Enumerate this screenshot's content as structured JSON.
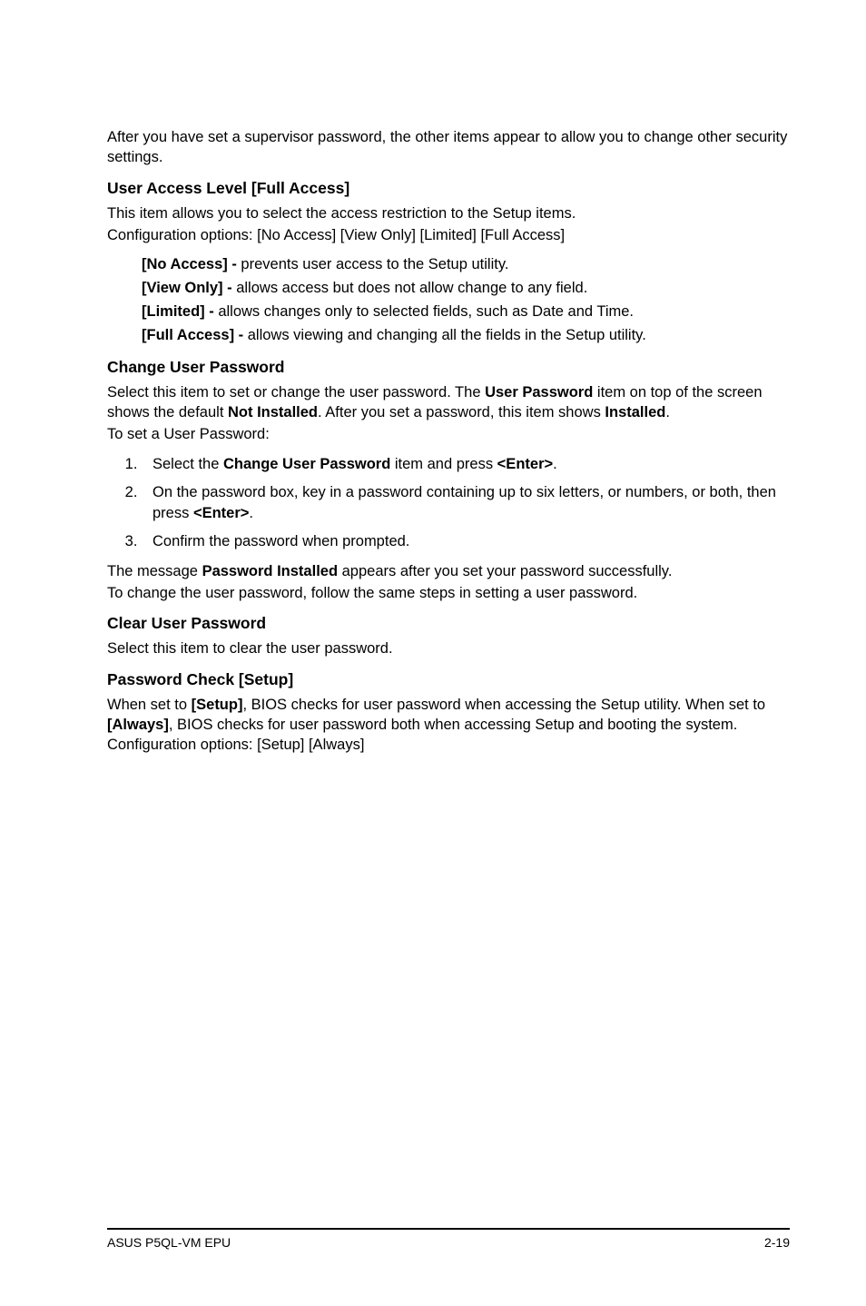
{
  "intro": "After you have set a supervisor password, the other items appear to allow you to change other security settings.",
  "ual": {
    "heading": "User Access Level [Full Access]",
    "desc1": "This item allows you to select the access restriction to the Setup items.",
    "desc2": "Configuration options: [No Access] [View Only] [Limited] [Full Access]",
    "opts": {
      "na_b": "[No Access] - ",
      "na_t": "prevents user access to the Setup utility.",
      "vo_b": "[View Only] - ",
      "vo_t": "allows access but does not allow change to any field.",
      "li_b": "[Limited] - ",
      "li_t": "allows changes only to selected fields, such as Date and Time.",
      "fa_b": "[Full Access] - ",
      "fa_t": "allows viewing and changing all the fields in the Setup utility."
    }
  },
  "cup": {
    "heading": "Change User Password",
    "p1a": "Select this item to set or change the user password. The ",
    "p1b": "User Password",
    "p1c": " item on top of the screen shows the default ",
    "p1d": "Not Installed",
    "p1e": ". After you set a password, this item shows ",
    "p1f": "Installed",
    "p1g": ".",
    "p2": "To set a User Password:",
    "s1a": "Select the ",
    "s1b": "Change User Password",
    "s1c": " item and press ",
    "s1d": "<Enter>",
    "s1e": ".",
    "s2a": "On the password box, key in a password containing up to six letters, or numbers, or both, then press ",
    "s2b": "<Enter>",
    "s2c": ".",
    "s3": "Confirm the password when prompted.",
    "p3a": "The message ",
    "p3b": "Password Installed",
    "p3c": " appears after you set your password successfully.",
    "p4": "To change the user password, follow the same steps in setting a user password."
  },
  "clr": {
    "heading": "Clear User Password",
    "p": "Select this item to clear the user password."
  },
  "pwc": {
    "heading": "Password Check [Setup]",
    "a": "When set to ",
    "b": "[Setup]",
    "c": ", BIOS checks for user password when accessing the Setup utility. When set to ",
    "d": "[Always]",
    "e": ", BIOS checks for user password both when accessing Setup and booting the system. Configuration options: [Setup] [Always]"
  },
  "footer": {
    "left": "ASUS P5QL-VM EPU",
    "right": "2-19"
  }
}
